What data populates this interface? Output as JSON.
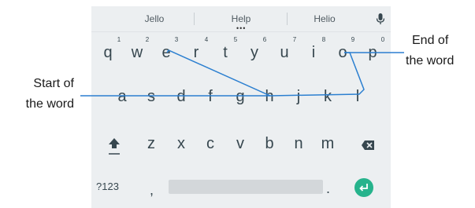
{
  "suggestions": [
    "Jello",
    "Help",
    "Helio"
  ],
  "keyboard": {
    "row1": [
      "q",
      "w",
      "e",
      "r",
      "t",
      "y",
      "u",
      "i",
      "o",
      "p"
    ],
    "row1_hints": [
      "1",
      "2",
      "3",
      "4",
      "5",
      "6",
      "7",
      "8",
      "9",
      "0"
    ],
    "row2": [
      "a",
      "s",
      "d",
      "f",
      "g",
      "h",
      "j",
      "k",
      "l"
    ],
    "row3": [
      "z",
      "x",
      "c",
      "v",
      "b",
      "n",
      "m"
    ],
    "symbols_label": "?123",
    "comma": ",",
    "period": "."
  },
  "annotations": {
    "start_line1": "Start of",
    "start_line2": "the word",
    "end_line1": "End of",
    "end_line2": "the word"
  },
  "colors": {
    "keyboard_bg": "#eceff1",
    "swipe_trail": "#2b7fd0",
    "enter_key": "#26b38c",
    "pointer_line": "#2b7fd0"
  },
  "icons": [
    "mic-icon",
    "shift-icon",
    "backspace-icon",
    "enter-icon"
  ]
}
